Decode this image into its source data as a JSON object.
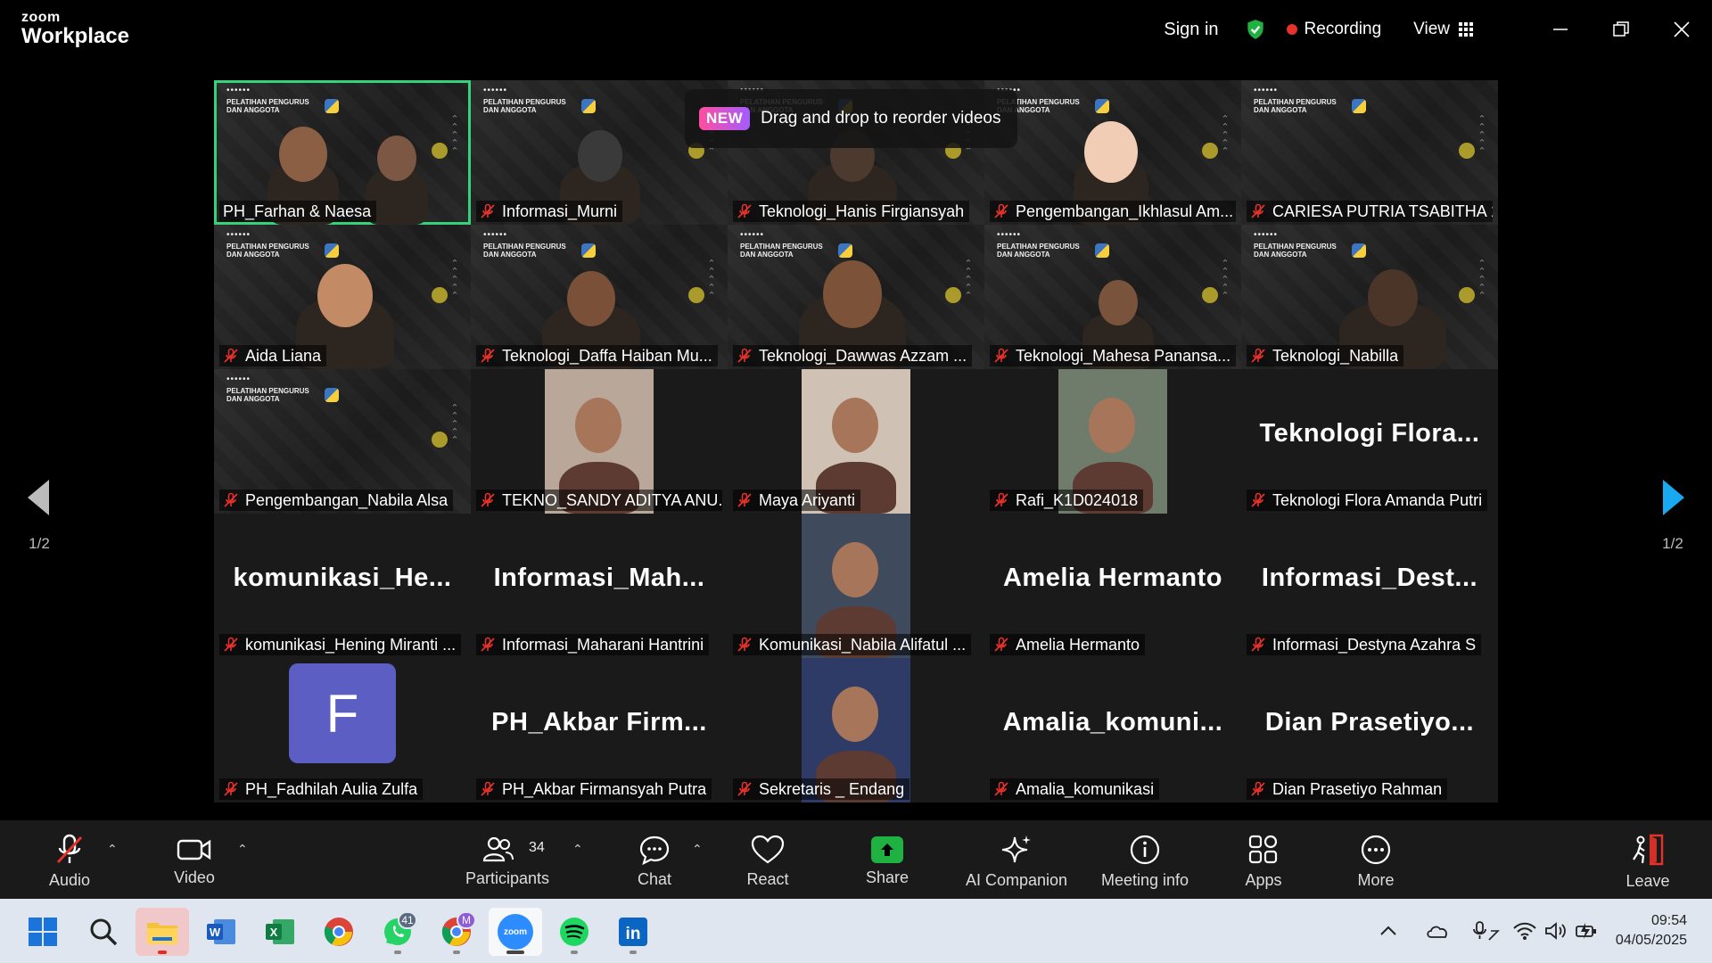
{
  "app": {
    "brand_top": "zoom",
    "brand_bottom": "Workplace"
  },
  "titlebar": {
    "sign_in": "Sign in",
    "recording": "Recording",
    "view": "View"
  },
  "banner": {
    "badge": "NEW",
    "text": "Drag and drop to reorder videos"
  },
  "slide_title": "PELATIHAN PENGURUS DAN ANGGOTA",
  "slide_dots": "••••••",
  "tiles": [
    {
      "label": "PH_Farhan & Naesa",
      "big": "",
      "kind": "slide",
      "muted": false
    },
    {
      "label": "Informasi_Murni",
      "big": "",
      "kind": "slide",
      "muted": true
    },
    {
      "label": "Teknologi_Hanis Firgiansyah",
      "big": "",
      "kind": "slide",
      "muted": true
    },
    {
      "label": "Pengembangan_Ikhlasul Am...",
      "big": "",
      "kind": "slide",
      "muted": true
    },
    {
      "label": "CARIESA PUTRIA TSABITHA 1",
      "big": "",
      "kind": "slide",
      "muted": true
    },
    {
      "label": "Aida Liana",
      "big": "",
      "kind": "slide",
      "muted": true
    },
    {
      "label": "Teknologi_Daffa Haiban Mu...",
      "big": "",
      "kind": "slide",
      "muted": true
    },
    {
      "label": "Teknologi_Dawwas Azzam ...",
      "big": "",
      "kind": "slide",
      "muted": true
    },
    {
      "label": "Teknologi_Mahesa Panansa...",
      "big": "",
      "kind": "slide",
      "muted": true
    },
    {
      "label": "Teknologi_Nabilla",
      "big": "",
      "kind": "slide",
      "muted": true
    },
    {
      "label": "Pengembangan_Nabila Alsa",
      "big": "",
      "kind": "slide",
      "muted": true
    },
    {
      "label": "TEKNO_SANDY ADITYA ANU...",
      "big": "",
      "kind": "cam",
      "muted": true
    },
    {
      "label": "Maya Ariyanti",
      "big": "",
      "kind": "cam",
      "muted": true
    },
    {
      "label": "Rafi_K1D024018",
      "big": "",
      "kind": "cam",
      "muted": true
    },
    {
      "label": "Teknologi Flora Amanda Putri",
      "big": "Teknologi  Flora...",
      "kind": "name",
      "muted": true
    },
    {
      "label": "komunikasi_Hening Miranti ...",
      "big": "komunikasi_He...",
      "kind": "name",
      "muted": true
    },
    {
      "label": "Informasi_Maharani Hantrini",
      "big": "Informasi_Mah...",
      "kind": "name",
      "muted": true
    },
    {
      "label": "Komunikasi_Nabila Alifatul ...",
      "big": "",
      "kind": "cam",
      "muted": true
    },
    {
      "label": "Amelia Hermanto",
      "big": "Amelia Hermanto",
      "kind": "name",
      "muted": true
    },
    {
      "label": "Informasi_Destyna Azahra S",
      "big": "Informasi_Dest...",
      "kind": "name",
      "muted": true
    },
    {
      "label": "PH_Fadhilah Aulia Zulfa",
      "big": "F",
      "kind": "avatar",
      "muted": true
    },
    {
      "label": "PH_Akbar Firmansyah Putra",
      "big": "PH_Akbar  Firm...",
      "kind": "name",
      "muted": true
    },
    {
      "label": "Sekretaris _ Endang",
      "big": "",
      "kind": "cam",
      "muted": true
    },
    {
      "label": "Amalia_komunikasi",
      "big": "Amalia_komuni...",
      "kind": "name",
      "muted": true
    },
    {
      "label": "Dian Prasetiyo Rahman",
      "big": "Dian  Prasetiyo...",
      "kind": "name",
      "muted": true
    }
  ],
  "pager": {
    "left": "1/2",
    "right": "1/2"
  },
  "toolbar": {
    "audio": "Audio",
    "video": "Video",
    "participants": "Participants",
    "participants_count": "34",
    "chat": "Chat",
    "react": "React",
    "share": "Share",
    "ai_companion": "AI Companion",
    "meeting_info": "Meeting info",
    "apps": "Apps",
    "more": "More",
    "leave": "Leave"
  },
  "taskbar": {
    "whatsapp_badge": "41",
    "chrome_profile": "M",
    "zoom_label": "zoom",
    "time": "09:54",
    "date": "04/05/2025"
  },
  "colors": {
    "active_speaker": "#33d17a",
    "recording_dot": "#e5332a",
    "mic_off": "#e5332a",
    "share_green": "#1fb141",
    "pager_arrow": "#19a9f0",
    "avatar_F": "#5c5ec4"
  }
}
